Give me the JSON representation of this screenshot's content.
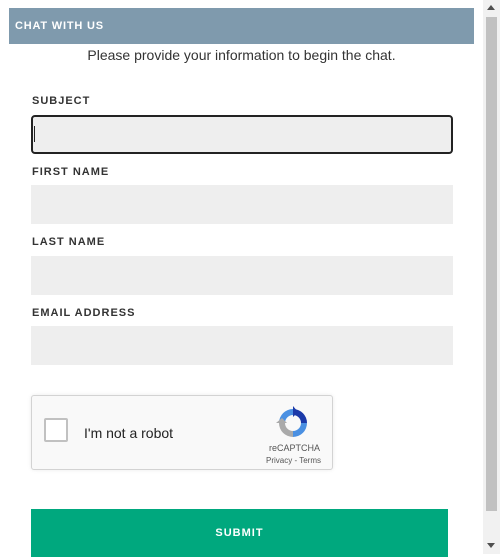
{
  "header": {
    "title": "CHAT WITH US"
  },
  "intro": {
    "text": "Please provide your information to begin the chat."
  },
  "form": {
    "subject": {
      "label": "SUBJECT",
      "value": ""
    },
    "first_name": {
      "label": "FIRST NAME",
      "value": ""
    },
    "last_name": {
      "label": "LAST NAME",
      "value": ""
    },
    "email": {
      "label": "EMAIL ADDRESS",
      "value": ""
    }
  },
  "recaptcha": {
    "checkbox_label": "I'm not a robot",
    "brand": "reCAPTCHA",
    "privacy": "Privacy",
    "separator": " - ",
    "terms": "Terms"
  },
  "submit": {
    "label": "SUBMIT"
  },
  "colors": {
    "header_bg": "#7f9aad",
    "field_bg": "#eeeeee",
    "submit_bg": "#00a87e"
  },
  "icons": [
    "recaptcha-logo-icon",
    "scroll-up-arrow-icon",
    "scroll-down-arrow-icon"
  ]
}
